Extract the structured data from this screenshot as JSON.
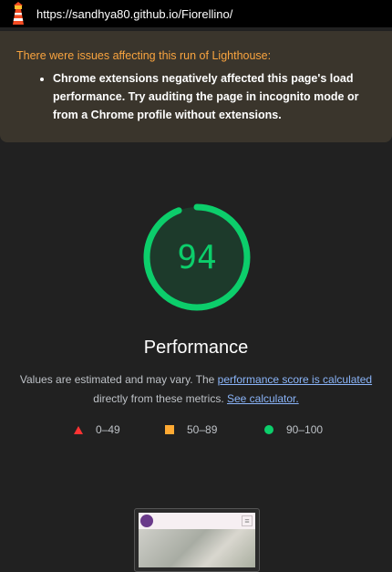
{
  "browser": {
    "url": "https://sandhya80.github.io/Fiorellino/"
  },
  "warning": {
    "heading": "There were issues affecting this run of Lighthouse:",
    "items": [
      "Chrome extensions negatively affected this page's load performance. Try auditing the page in incognito mode or from a Chrome profile without extensions."
    ]
  },
  "score": {
    "value": "94",
    "fraction": 0.94,
    "color": "#0cce6b"
  },
  "section": {
    "title": "Performance",
    "desc_text_1": "Values are estimated and may vary. The ",
    "desc_link_1": "performance score is calculated",
    "desc_text_2": " directly from these metrics. ",
    "desc_link_2": "See calculator."
  },
  "legend": [
    {
      "label": "0–49",
      "icon": "red-triangle-icon",
      "color": "#ff3333"
    },
    {
      "label": "50–89",
      "icon": "orange-square-icon",
      "color": "#ffaa33"
    },
    {
      "label": "90–100",
      "icon": "green-circle-icon",
      "color": "#0cce6b"
    }
  ],
  "thumbnail": {
    "menu_icon": "hamburger-icon"
  }
}
